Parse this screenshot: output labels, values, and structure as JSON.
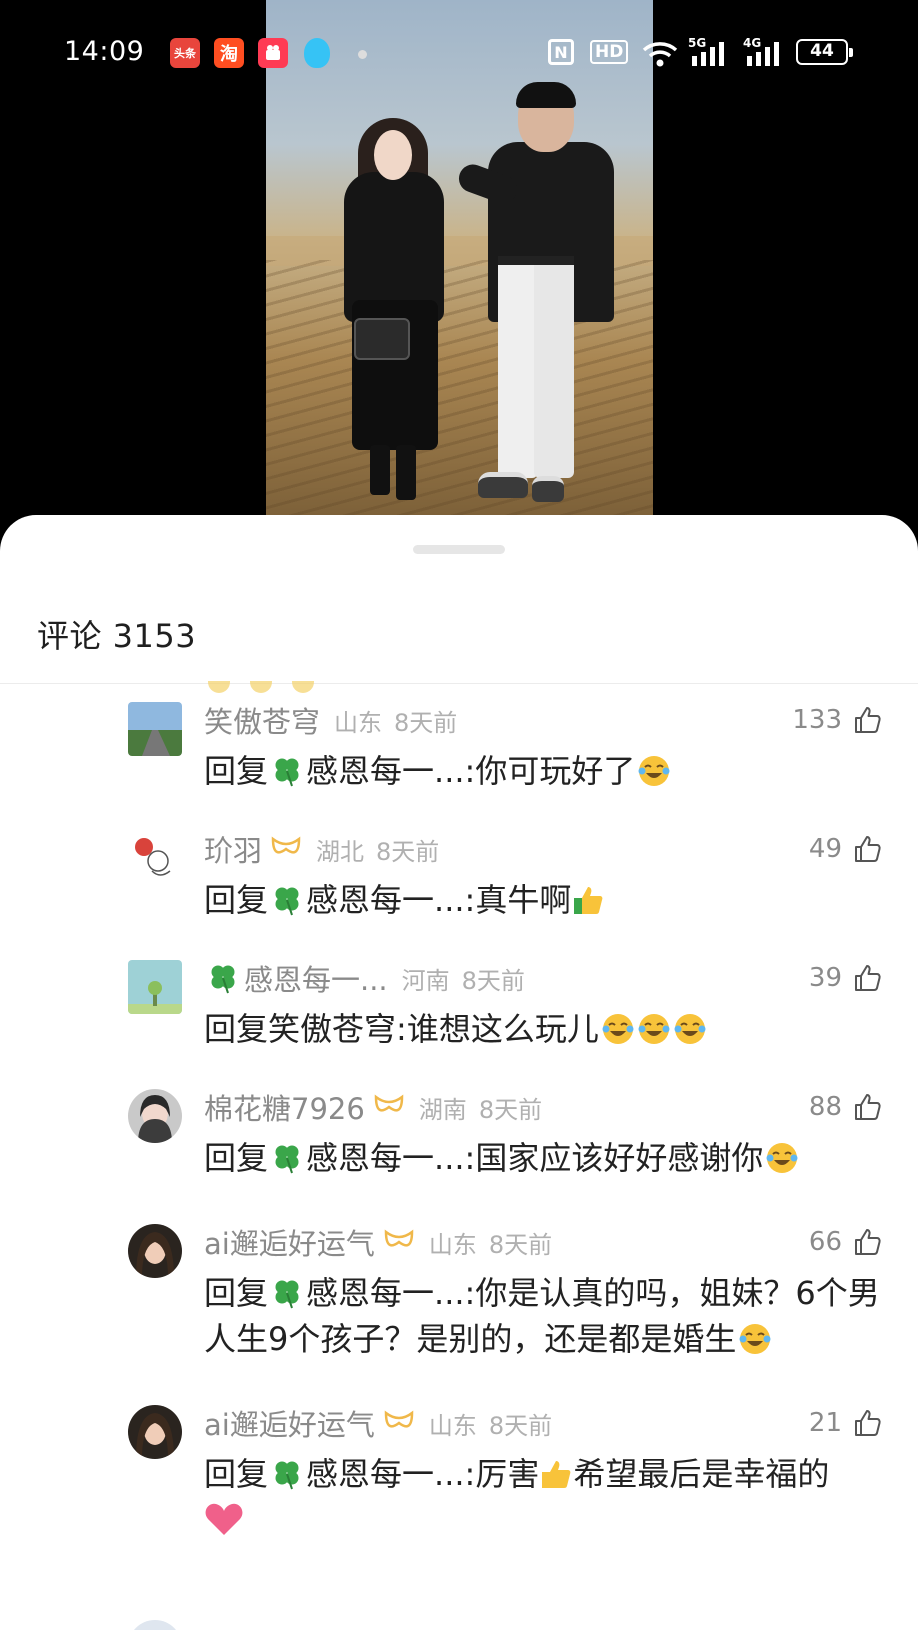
{
  "status_bar": {
    "time": "14:09",
    "apps": [
      {
        "name": "toutiao-app-icon",
        "label": "头条"
      },
      {
        "name": "taobao-app-icon",
        "label": "淘"
      },
      {
        "name": "kuaishou-app-icon",
        "label": ""
      }
    ],
    "hd_label": "HD",
    "nfc_label": "N",
    "signal_5g_label": "5G",
    "signal_4g_label": "4G",
    "battery_level": "44"
  },
  "video": {
    "description_icon": "video-player"
  },
  "comments_panel": {
    "title": "评论 3153",
    "comments": [
      {
        "username": "笑傲苍穹",
        "region": "山东",
        "time": "8天前",
        "likes": "133",
        "text": "回复",
        "reply_to": "感恩每一...",
        "content": ":你可玩好了",
        "avatar": "landscape-road-avatar",
        "has_badge": false
      },
      {
        "username": "玠羽",
        "region": "湖北",
        "time": "8天前",
        "likes": "49",
        "text": "回复",
        "reply_to": "感恩每一...",
        "content": ":真牛啊",
        "avatar": "cartoon-avatar",
        "has_badge": true
      },
      {
        "username": "感恩每一...",
        "region": "河南",
        "time": "8天前",
        "likes": "39",
        "text": "回复",
        "reply_to": "笑傲苍穹",
        "content": ":谁想这么玩儿",
        "avatar": "tree-sky-avatar",
        "has_badge": false
      },
      {
        "username": "棉花糖7926",
        "region": "湖南",
        "time": "8天前",
        "likes": "88",
        "text": "回复",
        "reply_to": "感恩每一...",
        "content": ":国家应该好好感谢你",
        "avatar": "woman-portrait-avatar",
        "has_badge": true
      },
      {
        "username": "ai邂逅好运气",
        "region": "山东",
        "time": "8天前",
        "likes": "66",
        "text": "回复",
        "reply_to": "感恩每一...",
        "content": ":你是认真的吗，姐妹？6个男人生9个孩子？是别的，还是都是婚生",
        "avatar": "woman-portrait-avatar-2",
        "has_badge": true
      },
      {
        "username": "ai邂逅好运气",
        "region": "山东",
        "time": "8天前",
        "likes": "21",
        "text": "回复",
        "reply_to": "感恩每一...",
        "content": ":厉害",
        "content_after": "希望最后是幸福的",
        "avatar": "woman-portrait-avatar-2",
        "has_badge": true
      }
    ]
  },
  "colors": {
    "username": "#8a8a8a",
    "meta": "#b0b0b0",
    "body": "#222222",
    "badge": "#f0b84a",
    "clover": "#3aa64a"
  }
}
